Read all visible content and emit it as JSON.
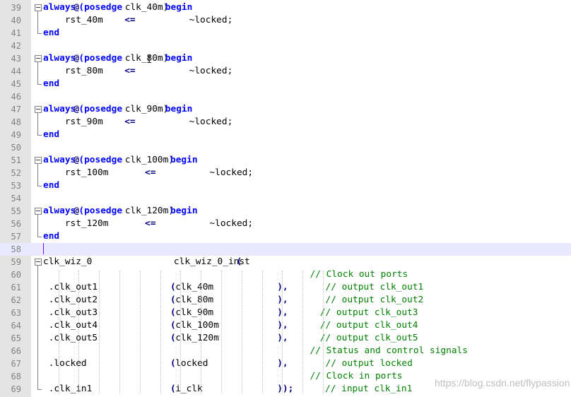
{
  "editor": {
    "lines": [
      {
        "num": "39",
        "fold": "start",
        "tokens": [
          {
            "t": "always",
            "c": "kw"
          },
          {
            "t": "@",
            "c": "op"
          },
          {
            "t": "(posedge",
            "c": "kw"
          },
          {
            "t": " clk_40m)",
            "c": "pl"
          },
          {
            "t": "begin",
            "c": "kw"
          }
        ]
      },
      {
        "num": "40",
        "fold": "mid",
        "tokens": [
          {
            "t": "    rst_40m     ",
            "c": "pl"
          },
          {
            "t": "<=",
            "c": "op"
          },
          {
            "t": "          ~locked;",
            "c": "pl"
          }
        ]
      },
      {
        "num": "41",
        "fold": "end",
        "tokens": [
          {
            "t": "end",
            "c": "kw"
          }
        ]
      },
      {
        "num": "42",
        "fold": "",
        "tokens": []
      },
      {
        "num": "43",
        "fold": "start",
        "tokens": [
          {
            "t": "always",
            "c": "kw"
          },
          {
            "t": "@",
            "c": "op"
          },
          {
            "t": "(posedge",
            "c": "kw"
          },
          {
            "t": " clk_80m)",
            "c": "pl"
          },
          {
            "t": "begin",
            "c": "kw"
          }
        ]
      },
      {
        "num": "44",
        "fold": "mid",
        "tokens": [
          {
            "t": "    rst_80m     ",
            "c": "pl"
          },
          {
            "t": "<=",
            "c": "op"
          },
          {
            "t": "          ~locked;",
            "c": "pl"
          }
        ]
      },
      {
        "num": "45",
        "fold": "end",
        "tokens": [
          {
            "t": "end",
            "c": "kw"
          }
        ]
      },
      {
        "num": "46",
        "fold": "",
        "tokens": []
      },
      {
        "num": "47",
        "fold": "start",
        "tokens": [
          {
            "t": "always",
            "c": "kw"
          },
          {
            "t": "@",
            "c": "op"
          },
          {
            "t": "(posedge",
            "c": "kw"
          },
          {
            "t": " clk_90m)",
            "c": "pl"
          },
          {
            "t": "begin",
            "c": "kw"
          }
        ]
      },
      {
        "num": "48",
        "fold": "mid",
        "tokens": [
          {
            "t": "    rst_90m     ",
            "c": "pl"
          },
          {
            "t": "<=",
            "c": "op"
          },
          {
            "t": "          ~locked;",
            "c": "pl"
          }
        ]
      },
      {
        "num": "49",
        "fold": "end",
        "tokens": [
          {
            "t": "end",
            "c": "kw"
          }
        ]
      },
      {
        "num": "50",
        "fold": "",
        "tokens": []
      },
      {
        "num": "51",
        "fold": "start",
        "tokens": [
          {
            "t": "always",
            "c": "kw"
          },
          {
            "t": "@",
            "c": "op"
          },
          {
            "t": "(posedge",
            "c": "kw"
          },
          {
            "t": " clk_100m)",
            "c": "pl"
          },
          {
            "t": "begin",
            "c": "kw"
          }
        ]
      },
      {
        "num": "52",
        "fold": "mid",
        "tokens": [
          {
            "t": "    rst_100m        ",
            "c": "pl"
          },
          {
            "t": "<=",
            "c": "op"
          },
          {
            "t": "          ~locked;",
            "c": "pl"
          }
        ]
      },
      {
        "num": "53",
        "fold": "end",
        "tokens": [
          {
            "t": "end",
            "c": "kw"
          }
        ]
      },
      {
        "num": "54",
        "fold": "",
        "tokens": []
      },
      {
        "num": "55",
        "fold": "start",
        "tokens": [
          {
            "t": "always",
            "c": "kw"
          },
          {
            "t": "@",
            "c": "op"
          },
          {
            "t": "(posedge",
            "c": "kw"
          },
          {
            "t": " clk_120m)",
            "c": "pl"
          },
          {
            "t": "begin",
            "c": "kw"
          }
        ]
      },
      {
        "num": "56",
        "fold": "mid",
        "tokens": [
          {
            "t": "    rst_120m        ",
            "c": "pl"
          },
          {
            "t": "<=",
            "c": "op"
          },
          {
            "t": "          ~locked;",
            "c": "pl"
          }
        ]
      },
      {
        "num": "57",
        "fold": "end",
        "tokens": [
          {
            "t": "end",
            "c": "kw"
          }
        ]
      },
      {
        "num": "58",
        "fold": "",
        "current": true,
        "tokens": []
      },
      {
        "num": "59",
        "fold": "start",
        "tokens": [
          {
            "t": "clk_wiz_0               clk_wiz_0_inst",
            "c": "pl"
          },
          {
            "t": "(",
            "c": "op"
          }
        ]
      },
      {
        "num": "60",
        "fold": "mid",
        "tokens": [
          {
            "t": "                                                 // Clock out ports",
            "c": "cm"
          }
        ]
      },
      {
        "num": "61",
        "fold": "mid",
        "tokens": [
          {
            "t": " .clk_out1               ",
            "c": "pl"
          },
          {
            "t": "(",
            "c": "op"
          },
          {
            "t": "clk_40m             ",
            "c": "pl"
          },
          {
            "t": "),",
            "c": "op"
          },
          {
            "t": "       // output clk_out1",
            "c": "cm"
          }
        ]
      },
      {
        "num": "62",
        "fold": "mid",
        "tokens": [
          {
            "t": " .clk_out2               ",
            "c": "pl"
          },
          {
            "t": "(",
            "c": "op"
          },
          {
            "t": "clk_80m             ",
            "c": "pl"
          },
          {
            "t": "),",
            "c": "op"
          },
          {
            "t": "       // output clk_out2",
            "c": "cm"
          }
        ]
      },
      {
        "num": "63",
        "fold": "mid",
        "tokens": [
          {
            "t": " .clk_out3               ",
            "c": "pl"
          },
          {
            "t": "(",
            "c": "op"
          },
          {
            "t": "clk_90m             ",
            "c": "pl"
          },
          {
            "t": "),",
            "c": "op"
          },
          {
            "t": "      // output clk_out3",
            "c": "cm"
          }
        ]
      },
      {
        "num": "64",
        "fold": "mid",
        "tokens": [
          {
            "t": " .clk_out4               ",
            "c": "pl"
          },
          {
            "t": "(",
            "c": "op"
          },
          {
            "t": "clk_100m            ",
            "c": "pl"
          },
          {
            "t": "),",
            "c": "op"
          },
          {
            "t": "      // output clk_out4",
            "c": "cm"
          }
        ]
      },
      {
        "num": "65",
        "fold": "mid",
        "tokens": [
          {
            "t": " .clk_out5               ",
            "c": "pl"
          },
          {
            "t": "(",
            "c": "op"
          },
          {
            "t": "clk_120m            ",
            "c": "pl"
          },
          {
            "t": "),",
            "c": "op"
          },
          {
            "t": "      // output clk_out5",
            "c": "cm"
          }
        ]
      },
      {
        "num": "66",
        "fold": "mid",
        "tokens": [
          {
            "t": "                                                 // Status and control signals",
            "c": "cm"
          }
        ]
      },
      {
        "num": "67",
        "fold": "mid",
        "tokens": [
          {
            "t": " .locked                 ",
            "c": "pl"
          },
          {
            "t": "(",
            "c": "op"
          },
          {
            "t": "locked              ",
            "c": "pl"
          },
          {
            "t": "),",
            "c": "op"
          },
          {
            "t": "       // output locked",
            "c": "cm"
          }
        ]
      },
      {
        "num": "68",
        "fold": "mid",
        "tokens": [
          {
            "t": "                                                 // Clock in ports",
            "c": "cm"
          }
        ]
      },
      {
        "num": "69",
        "fold": "end",
        "tokens": [
          {
            "t": " .clk_in1                ",
            "c": "pl"
          },
          {
            "t": "(",
            "c": "op"
          },
          {
            "t": "i_clk               ",
            "c": "pl"
          },
          {
            "t": "));",
            "c": "op"
          },
          {
            "t": "      // input clk_in1",
            "c": "cm"
          }
        ]
      }
    ]
  },
  "watermark": "https://blog.csdn.net/flypassion",
  "colors": {
    "keyword": "#0000ff",
    "operator": "#000080",
    "comment": "#008000",
    "gutter": "#e4e4e4",
    "current_line": "#e8e8ff",
    "caret": "#8000ff"
  }
}
